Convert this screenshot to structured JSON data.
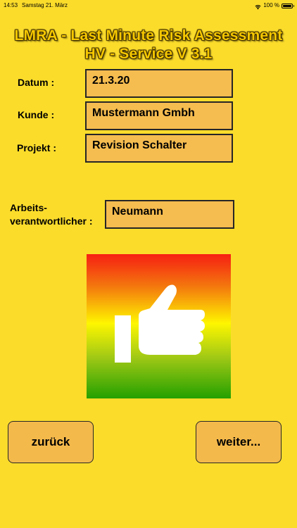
{
  "status_bar": {
    "time": "14:53",
    "date": "Samstag 21. März",
    "battery_percent": "100 %",
    "icons": [
      "wifi-icon",
      "battery-icon"
    ]
  },
  "title": {
    "line1": "LMRA - Last Minute Risk Assessment",
    "line2": "HV - Service V 3.1"
  },
  "form": {
    "datum": {
      "label": "Datum :",
      "value": "21.3.20"
    },
    "kunde": {
      "label": "Kunde :",
      "value": "Mustermann Gmbh"
    },
    "projekt": {
      "label": "Projekt :",
      "value": "Revision Schalter"
    },
    "arbeitsverantwortlicher": {
      "label_line1": "Arbeits-",
      "label_line2": "verantwortlicher :",
      "value": "Neumann"
    }
  },
  "thumb_panel": {
    "icon": "thumbs-up-icon",
    "gradient_colors": [
      "#f61f12",
      "#f4760e",
      "#fef600",
      "#9ec815",
      "#24a000"
    ]
  },
  "buttons": {
    "back_label": "zurück",
    "next_label": "weiter..."
  },
  "colors": {
    "background": "#fbdc2b",
    "field_fill": "#f5bc4f",
    "button_fill": "#f4b94b",
    "title_text": "#f6c800"
  }
}
